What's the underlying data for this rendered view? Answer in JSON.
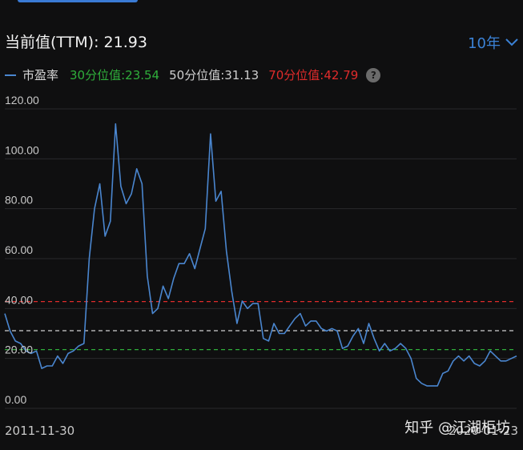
{
  "header": {
    "current_label": "当前值(TTM):",
    "current_value": "21.93",
    "period": "10年"
  },
  "legend": {
    "pe_label": "市盈率",
    "p30": "30分位值:23.54",
    "p50": "50分位值:31.13",
    "p70": "70分位值:42.79"
  },
  "watermark": "知乎 @江湖柜坊",
  "colors": {
    "series": "#4a86cf",
    "p30": "#2fae3b",
    "p50": "#cfcfcf",
    "p70": "#e02b2b",
    "accent": "#3b82d6"
  },
  "chart_data": {
    "type": "line",
    "title": "",
    "xlabel": "",
    "ylabel": "",
    "x_start": "2011-11-30",
    "x_end": "2020-01-23",
    "ylim": [
      0,
      120
    ],
    "yticks": [
      "0.00",
      "20.00",
      "40.00",
      "60.00",
      "80.00",
      "100.00",
      "120.00"
    ],
    "grid": true,
    "reference_lines": [
      {
        "name": "30分位值",
        "value": 23.54
      },
      {
        "name": "50分位值",
        "value": 31.13
      },
      {
        "name": "70分位值",
        "value": 42.79
      }
    ],
    "series": [
      {
        "name": "市盈率",
        "values": [
          38,
          31,
          27,
          26,
          23,
          22,
          23,
          16,
          17,
          17,
          21,
          18,
          22,
          23,
          25,
          26,
          60,
          80,
          90,
          69,
          75,
          114,
          89,
          82,
          86,
          96,
          90,
          53,
          38,
          40,
          49,
          44,
          52,
          58,
          58,
          62,
          56,
          64,
          72,
          110,
          83,
          87,
          63,
          47,
          34,
          43,
          40,
          42,
          42,
          28,
          27,
          34,
          30,
          30,
          33,
          36,
          38,
          33,
          35,
          35,
          32,
          31,
          32,
          31,
          24,
          25,
          29,
          32,
          26,
          34,
          28,
          23,
          26,
          23,
          24,
          26,
          24,
          20,
          12,
          10,
          9,
          9,
          9,
          14,
          15,
          19,
          21,
          19,
          21,
          18,
          17,
          19,
          23,
          21,
          19,
          19,
          20,
          21
        ]
      }
    ]
  }
}
